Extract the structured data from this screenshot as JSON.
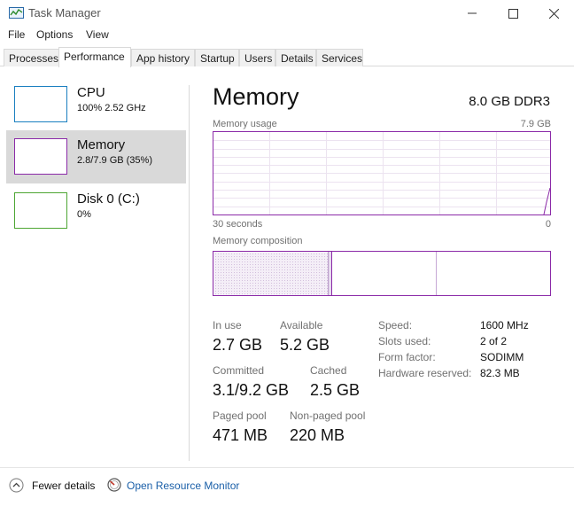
{
  "window": {
    "title": "Task Manager"
  },
  "menu": {
    "items": [
      "File",
      "Options",
      "View"
    ]
  },
  "tabs": [
    "Processes",
    "Performance",
    "App history",
    "Startup",
    "Users",
    "Details",
    "Services"
  ],
  "active_tab": "Performance",
  "resources": [
    {
      "name": "CPU",
      "detail": "100%  2.52 GHz",
      "color": "#1a7fc0",
      "selected": false
    },
    {
      "name": "Memory",
      "detail": "2.8/7.9 GB (35%)",
      "color": "#8b2aa8",
      "selected": true
    },
    {
      "name": "Disk 0 (C:)",
      "detail": "0%",
      "color": "#4da633",
      "selected": false
    }
  ],
  "memory": {
    "title": "Memory",
    "spec": "8.0 GB DDR3",
    "usage_graph": {
      "label": "Memory usage",
      "max_label": "7.9 GB",
      "time_label": "30 seconds",
      "min_label": "0"
    },
    "composition_label": "Memory composition",
    "stats": {
      "in_use": {
        "label": "In use",
        "value": "2.7 GB"
      },
      "available": {
        "label": "Available",
        "value": "5.2 GB"
      },
      "committed": {
        "label": "Committed",
        "value": "3.1/9.2 GB"
      },
      "cached": {
        "label": "Cached",
        "value": "2.5 GB"
      },
      "paged_pool": {
        "label": "Paged pool",
        "value": "471 MB"
      },
      "non_paged_pool": {
        "label": "Non-paged pool",
        "value": "220 MB"
      }
    },
    "details": [
      {
        "label": "Speed:",
        "value": "1600 MHz"
      },
      {
        "label": "Slots used:",
        "value": "2 of 2"
      },
      {
        "label": "Form factor:",
        "value": "SODIMM"
      },
      {
        "label": "Hardware reserved:",
        "value": "82.3 MB"
      }
    ]
  },
  "footer": {
    "fewer_details": "Fewer details",
    "open_monitor": "Open Resource Monitor"
  },
  "colors": {
    "memory_accent": "#8b2aa8",
    "link": "#1a5fa8"
  }
}
